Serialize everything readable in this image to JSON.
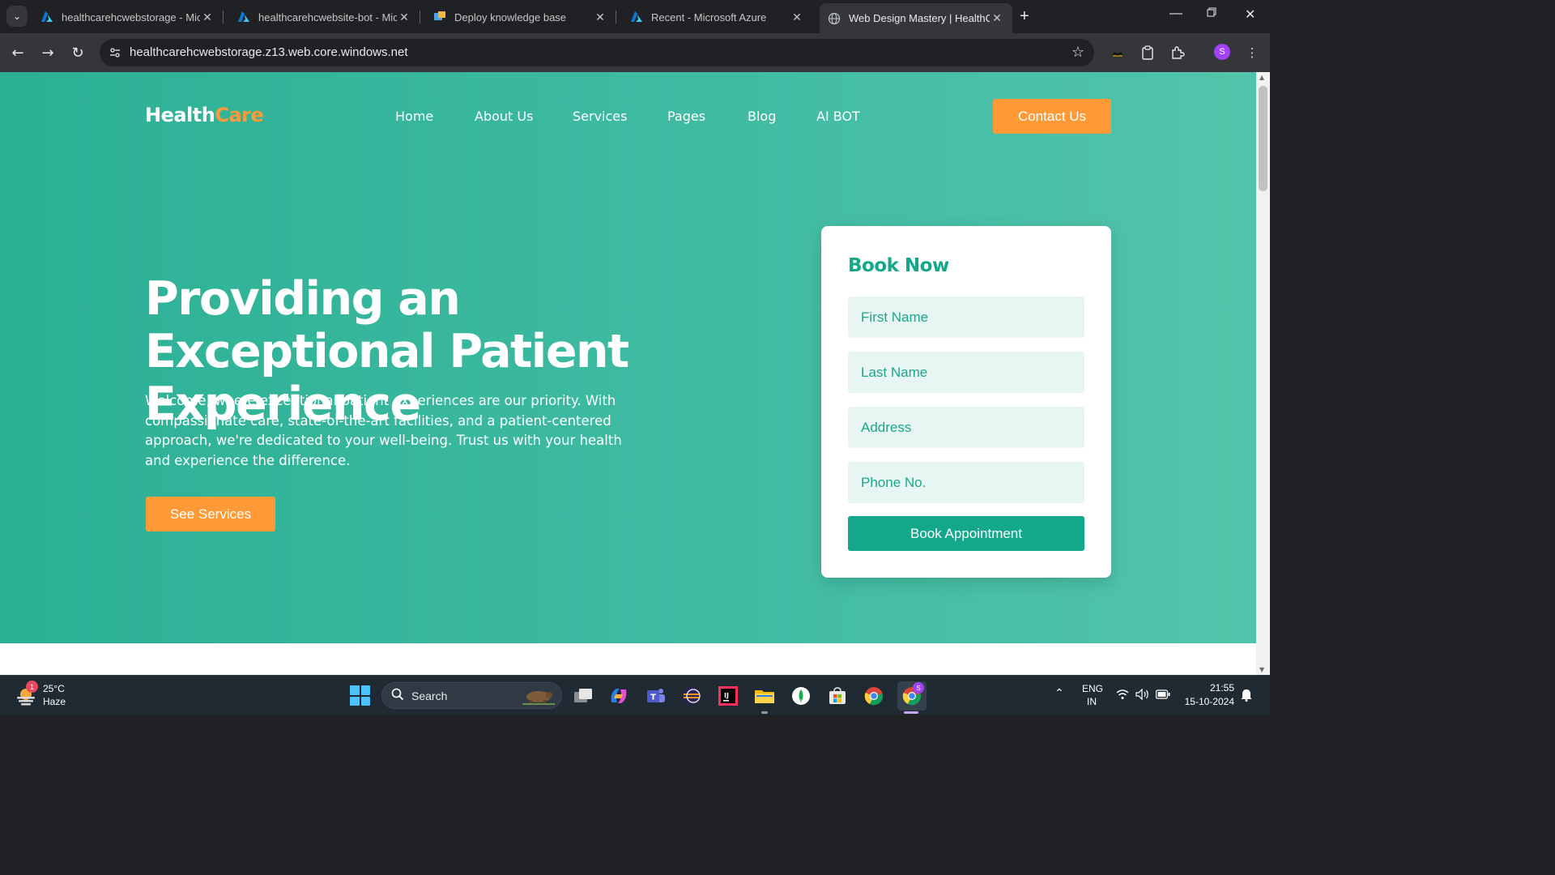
{
  "browser": {
    "tabs": [
      {
        "title": "healthcarehcwebstorage - Micro",
        "icon": "azure-icon",
        "active": false
      },
      {
        "title": "healthcarehcwebsite-bot - Micro",
        "icon": "azure-icon",
        "active": false
      },
      {
        "title": "Deploy knowledge base",
        "icon": "qna-maker-icon",
        "active": false
      },
      {
        "title": "Recent - Microsoft Azure",
        "icon": "azure-icon",
        "active": false
      },
      {
        "title": "Web Design Mastery | HealthCare",
        "icon": "globe-icon",
        "active": true
      }
    ],
    "url": "healthcarehcwebstorage.z13.web.core.windows.net",
    "profile_initial": "S"
  },
  "page": {
    "logo": {
      "part1": "Health",
      "part2": "Care"
    },
    "nav": [
      "Home",
      "About Us",
      "Services",
      "Pages",
      "Blog",
      "AI BOT"
    ],
    "contact_label": "Contact Us",
    "hero": {
      "title": "Providing an Exceptional Patient Experience",
      "description": "Welcome, where exceptional patient experiences are our priority. With compassionate care, state-of-the-art facilities, and a patient-centered approach, we're dedicated to your well-being. Trust us with your health and experience the difference.",
      "button_label": "See Services"
    },
    "booking": {
      "title": "Book Now",
      "fields": [
        "First Name",
        "Last Name",
        "Address",
        "Phone No."
      ],
      "button_label": "Book Appointment"
    }
  },
  "taskbar": {
    "weather": {
      "temp": "25°C",
      "condition": "Haze",
      "badge": "1"
    },
    "search_label": "Search",
    "lang": {
      "line1": "ENG",
      "line2": "IN"
    },
    "time": "21:55",
    "date": "15-10-2024",
    "chrome_badge": "S"
  },
  "colors": {
    "hero_teal": "#3fbba2",
    "accent_orange": "#ff9a36",
    "brand_green": "#14a88a",
    "field_bg": "#e8f6f3"
  }
}
